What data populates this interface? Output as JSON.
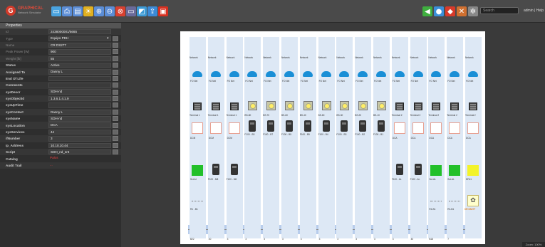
{
  "app": {
    "logo_letter": "G",
    "logo_name": "GRAPHICAL",
    "logo_sub": "Network Simulator"
  },
  "toolbar": {
    "left_icons": [
      "select-icon",
      "print-icon",
      "folder-icon",
      "lightbulb-icon",
      "zoom-in-icon",
      "zoom-out-icon",
      "search-red-icon",
      "rectangle-icon",
      "layers-icon",
      "export-icon",
      "pdf-icon"
    ],
    "right_icons": [
      "arrow-left-icon",
      "globe-icon",
      "tag-icon",
      "tools-icon",
      "gear-icon"
    ],
    "search_placeholder": "Search",
    "user": "admin",
    "help": "Help"
  },
  "properties": {
    "title": "Properties",
    "rows": [
      {
        "label": "Id",
        "value": "2438000001/5665",
        "dim": true
      },
      {
        "label": "Type",
        "value": "Equipo PDH",
        "dim": true,
        "dropdown": true
      },
      {
        "label": "Name",
        "value": "CR DS277",
        "dim": true,
        "btn": true
      },
      {
        "label": "Peak Power [W]",
        "value": "900",
        "dim": true,
        "btn": true
      },
      {
        "label": "Weight [lb]",
        "value": "55",
        "dim": true,
        "btn": true
      },
      {
        "label": "Status",
        "value": "Active",
        "btn": true
      },
      {
        "label": "Assigned To",
        "value": "Danny L",
        "btn": true
      },
      {
        "label": "End Of Life",
        "value": "",
        "btn": true
      },
      {
        "label": "Comments",
        "value": "",
        "btn": true
      },
      {
        "label": "sysDescr",
        "value": "SDH-nd",
        "btn": true
      },
      {
        "label": "sysObjectId",
        "value": "1.3.6.1.4.1.9",
        "btn": true
      },
      {
        "label": "sysUpTime",
        "value": "",
        "btn": true
      },
      {
        "label": "sysContact",
        "value": "Danny L",
        "btn": true
      },
      {
        "label": "sysName",
        "value": "SDH-nd",
        "btn": true
      },
      {
        "label": "sysLocation",
        "value": "DCA",
        "btn": true
      },
      {
        "label": "sysServices",
        "value": "44",
        "btn": true
      },
      {
        "label": "ifNumber",
        "value": "3",
        "btn": true
      },
      {
        "label": "ip_Address",
        "value": "10.10.10.44",
        "btn": true
      },
      {
        "label": "Script",
        "value": "SDH_nd_sr3",
        "btn": true
      },
      {
        "label": "Catalog",
        "value": "Palos",
        "red": true
      },
      {
        "label": "Audit Trail",
        "value": "...",
        "red": true
      }
    ]
  },
  "diagram": {
    "columns": [
      {
        "top": "Network",
        "cloud": "FO Net",
        "equip": "server",
        "equip_label": "Terminal 1",
        "box": "red",
        "box_label": "DCM",
        "sbox": "green",
        "sbox_label": "Sct-AI",
        "dots": true,
        "dots_label": "R1 - B1",
        "bottom": "B22"
      },
      {
        "top": "Network",
        "cloud": "FO Net",
        "equip": "server",
        "equip_label": "Terminal 1",
        "box": "red",
        "box_label": "DCM",
        "dev": true,
        "dev_label": "F100 - M8",
        "bottom": "40"
      },
      {
        "top": "Network",
        "cloud": "FO Net",
        "equip": "server",
        "equip_label": "Terminal 1",
        "box": "red",
        "box_label": "DCM",
        "dev": true,
        "dev_label": "F100 - M8",
        "bottom": "3"
      },
      {
        "top": "Network",
        "cloud": "FO Net",
        "equip": "chip",
        "equip_label": "BS-80",
        "dev2": true,
        "dev2_label": "F100 - B3",
        "bottom": "3"
      },
      {
        "top": "Network",
        "cloud": "FO Net",
        "equip": "chip",
        "equip_label": "BS-70",
        "dev2": true,
        "dev2_label": "F100 - B7",
        "bottom": "3"
      },
      {
        "top": "Network",
        "cloud": "FO Net",
        "equip": "chip",
        "equip_label": "BS-60",
        "dev2": true,
        "dev2_label": "F100 - B5",
        "bottom": "3"
      },
      {
        "top": "Network",
        "cloud": "FO Net",
        "equip": "chip",
        "equip_label": "BS-40",
        "dev2": true,
        "dev2_label": "F100 - B5",
        "bottom": "3"
      },
      {
        "top": "Network",
        "cloud": "FO Net",
        "equip": "chip",
        "equip_label": "BS-60",
        "dev2": true,
        "dev2_label": "F100 - B4",
        "bottom": "3"
      },
      {
        "top": "Network",
        "cloud": "FO Net",
        "equip": "chip",
        "equip_label": "BS-30",
        "dev2": true,
        "dev2_label": "F100 - B3",
        "bottom": "3"
      },
      {
        "top": "Network",
        "cloud": "FO Net",
        "equip": "chip",
        "equip_label": "BS-20",
        "dev2": true,
        "dev2_label": "F100 - B2",
        "bottom": "3"
      },
      {
        "top": "Network",
        "cloud": "FO Net",
        "equip": "chip",
        "equip_label": "BS-10",
        "dev2": true,
        "dev2_label": "F100 - B1",
        "bottom": "3"
      },
      {
        "top": "Network",
        "cloud": "FO Net",
        "equip": "server",
        "equip_label": "Terminal 2",
        "box": "red",
        "box_label": "DCA",
        "dev": true,
        "dev_label": "F100 - AL",
        "bottom": "3"
      },
      {
        "top": "Network",
        "cloud": "FO Net",
        "equip": "server",
        "equip_label": "Terminal 2",
        "box": "red",
        "box_label": "DCA",
        "dev": true,
        "dev_label": "F100 - AL",
        "bottom": "40"
      },
      {
        "top": "Network",
        "cloud": "FO Net",
        "equip": "server",
        "equip_label": "Terminal 2",
        "box": "red",
        "box_label": "DCA",
        "sbox": "green",
        "sbox_label": "Sct-AL",
        "dots": true,
        "dots_label": "R1-B1",
        "bottom": "B18"
      },
      {
        "top": "Network",
        "cloud": "FO Net",
        "equip": "server",
        "equip_label": "Terminal 2",
        "box": "red",
        "box_label": "DCA",
        "sbox": "green",
        "sbox_label": "Sct-AL",
        "dots": true,
        "dots_label": "R1-B1",
        "bottom": "7"
      },
      {
        "top": "Network",
        "cloud": "FO Net",
        "equip": "server",
        "equip_label": "Terminal 2",
        "box": "red",
        "box_label": "DCA",
        "sbox": "yellow",
        "sbox_label": "DFA1",
        "gear": true,
        "gear_label": "CR DS277",
        "bottom": ""
      }
    ]
  },
  "statusbar": {
    "zoom": "Zoom: 100%"
  }
}
